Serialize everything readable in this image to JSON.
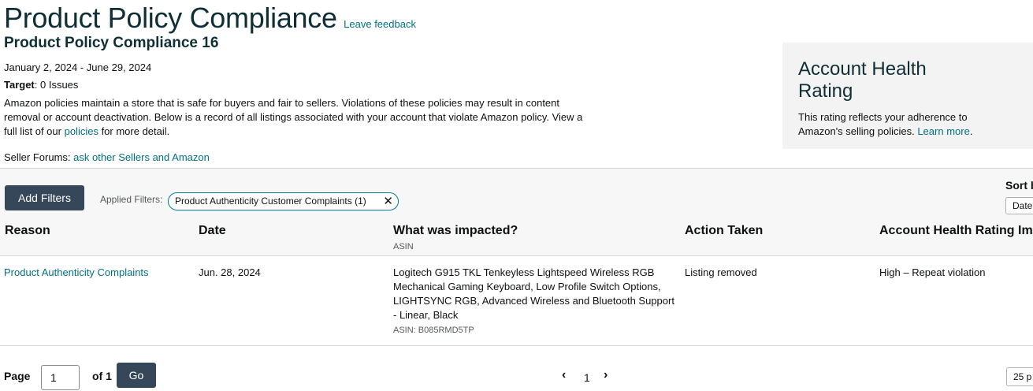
{
  "header": {
    "title": "Product Policy Compliance",
    "feedback_link": "Leave feedback",
    "subtitle": "Product Policy Compliance 16",
    "date_range": "January 2, 2024 - June 29, 2024",
    "target_label": "Target",
    "target_value": ": 0 Issues",
    "description_before_link": "Amazon policies maintain a store that is safe for buyers and fair to sellers. Violations of these policies may result in content removal or account deactivation. Below is a record of all listings associated with your account that violate Amazon policy. View a full list of our ",
    "description_link": "policies",
    "description_after_link": " for more detail.",
    "forums_label": "Seller Forums: ",
    "forums_link": "ask other Sellers and Amazon"
  },
  "account_health": {
    "title": "Account Health Rating",
    "text": "This rating reflects your adherence to Amazon's selling policies. ",
    "learn_more": "Learn more",
    "period": "."
  },
  "filters": {
    "add_filters_label": "Add Filters",
    "applied_label": "Applied Filters:",
    "chip_label": "Product Authenticity Customer Complaints (1)",
    "chip_remove_glyph": "✕",
    "sort_label": "Sort b",
    "sort_value": "Date"
  },
  "table": {
    "columns": {
      "reason": "Reason",
      "date": "Date",
      "impacted": "What was impacted?",
      "impacted_sub": "ASIN",
      "action": "Action Taken",
      "rating_impact": "Account Health Rating Imp"
    },
    "rows": [
      {
        "reason": "Product Authenticity Complaints",
        "date": "Jun. 28, 2024",
        "impacted": "Logitech G915 TKL Tenkeyless Lightspeed Wireless RGB Mechanical Gaming Keyboard, Low Profile Switch Options, LIGHTSYNC RGB, Advanced Wireless and Bluetooth Support - Linear, Black",
        "asin": "ASIN: B085RMD5TP",
        "action": "Listing removed",
        "rating_impact": "High – Repeat violation"
      }
    ]
  },
  "pagination": {
    "page_label": "Page",
    "page_value": "1",
    "of_label": "of 1",
    "go_label": "Go",
    "prev_glyph": "‹",
    "current": "1",
    "next_glyph": "›",
    "per_page": "25 p"
  },
  "colors": {
    "link": "#007185",
    "dark_button": "#37475a",
    "chip_border": "#008296",
    "band_bg": "#f7f7f7"
  }
}
